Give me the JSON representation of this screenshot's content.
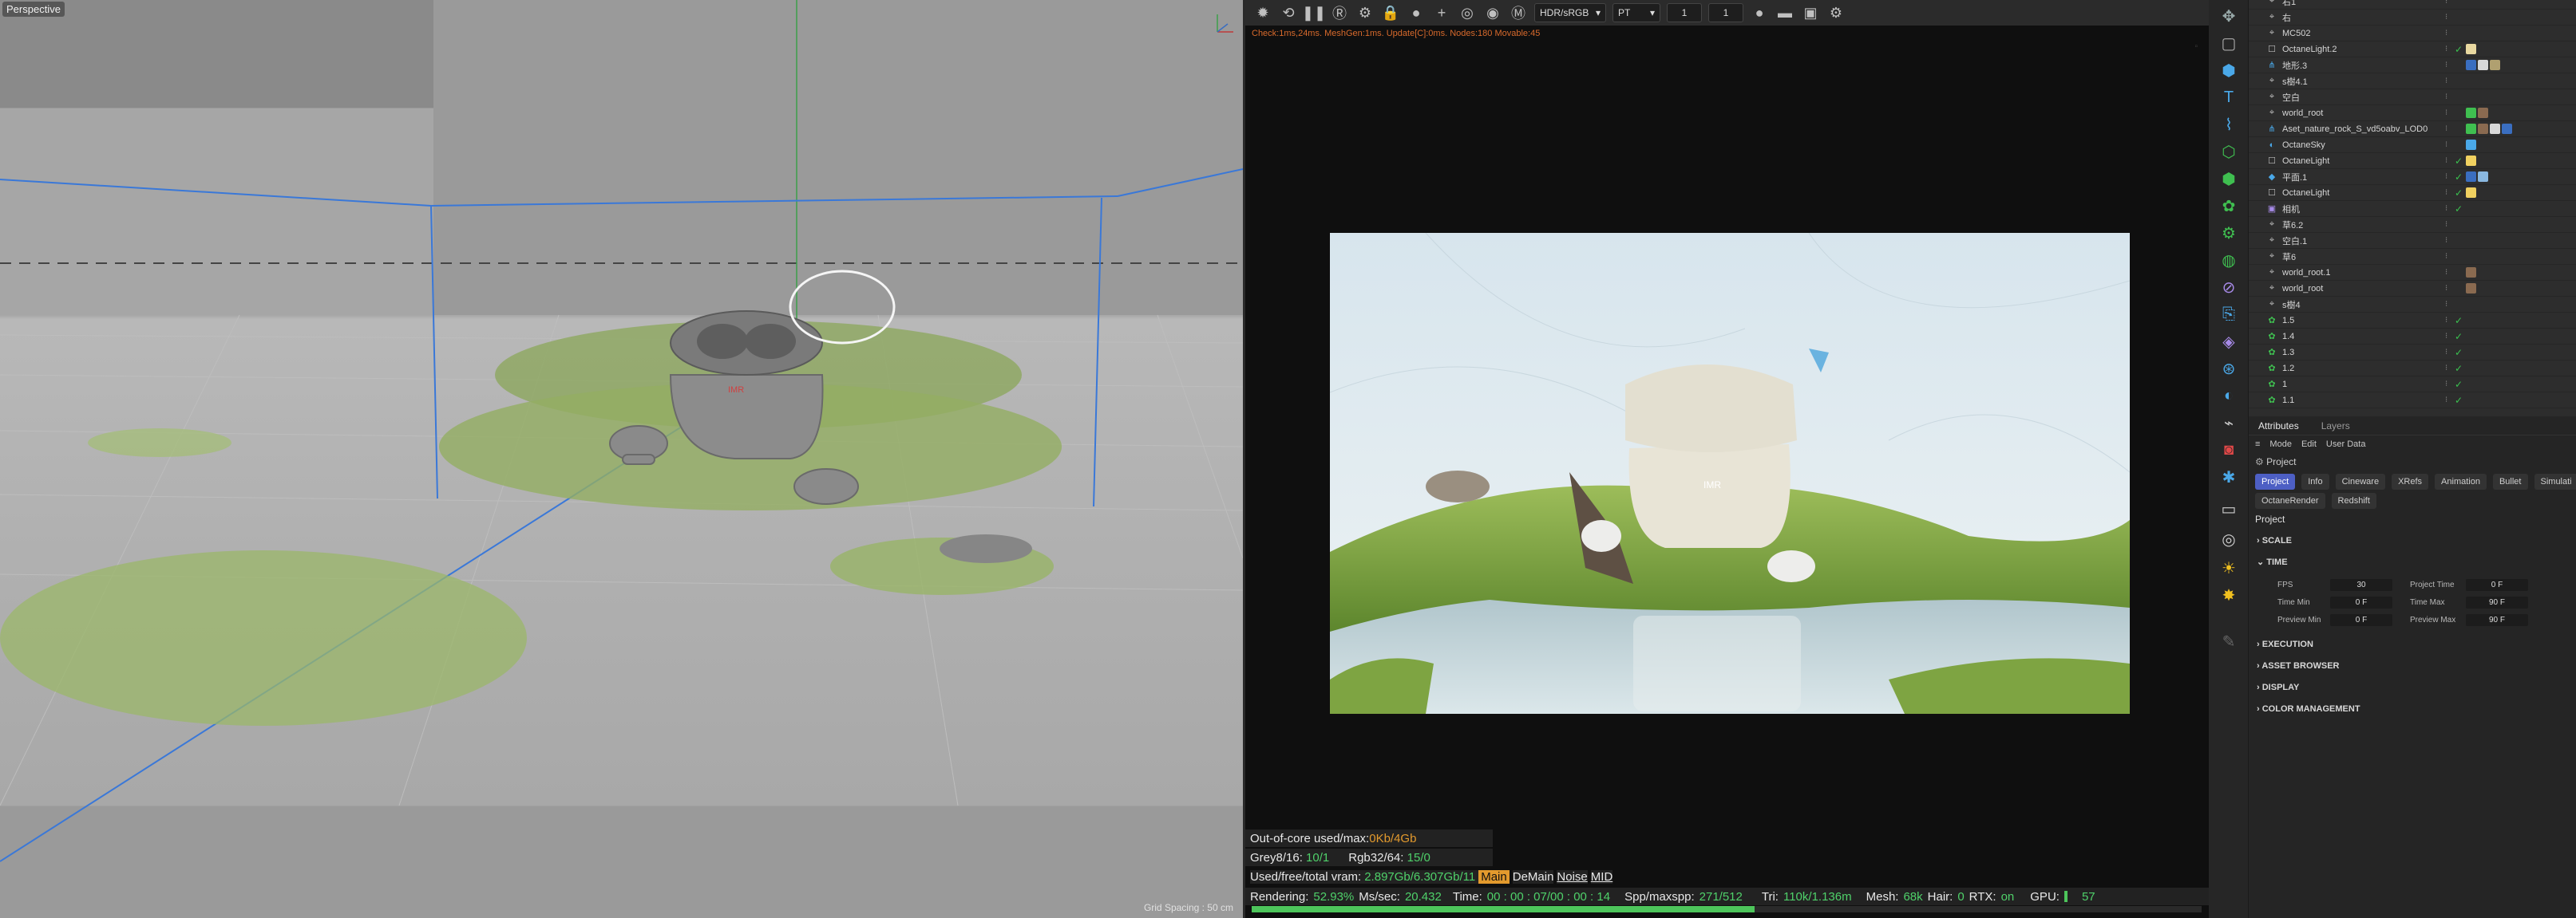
{
  "viewport": {
    "label": "Perspective",
    "grid_spacing": "Grid Spacing : 50 cm"
  },
  "render_window": {
    "toolbar": {
      "color_space": "HDR/sRGB",
      "kernel": "PT",
      "num1": "1",
      "num2": "1"
    },
    "check_line": "Check:1ms,24ms. MeshGen:1ms. Update[C]:0ms. Nodes:180 Movable:45",
    "stats": {
      "out_of_core_label": "Out-of-core used/max:",
      "out_of_core_value": "0Kb/4Gb",
      "grey_label": "Grey8/16:",
      "grey_value": "10/1",
      "rgb_label": "Rgb32/64:",
      "rgb_value": "15/0",
      "vram_label": "Used/free/total vram:",
      "vram_value": "2.897Gb/6.307Gb/11",
      "mode_main": "Main",
      "mode_demain": "DeMain",
      "mode_noise": "Noise",
      "mode_mid": "MID",
      "rendering_label": "Rendering:",
      "rendering_value": "52.93%",
      "mssec_label": "Ms/sec:",
      "mssec_value": "20.432",
      "time_label": "Time:",
      "time_value": "00 : 00 : 07/00 : 00 : 14",
      "spp_label": "Spp/maxspp:",
      "spp_value": "271/512",
      "tri_label": "Tri:",
      "tri_value": "110k/1.136m",
      "mesh_label": "Mesh:",
      "mesh_value": "68k",
      "hair_label": "Hair:",
      "hair_value": "0",
      "rtx_label": "RTX:",
      "rtx_value": "on",
      "gpu_label": "GPU:",
      "gpu_value": "57"
    },
    "progress": 0.5293
  },
  "objects": [
    {
      "name": "右1",
      "icon": "null-icon"
    },
    {
      "name": "右",
      "icon": "null-icon"
    },
    {
      "name": "MC502",
      "icon": "null-icon"
    },
    {
      "name": "OctaneLight.2",
      "icon": "light-icon"
    },
    {
      "name": "地形.3",
      "icon": "scatter-icon"
    },
    {
      "name": "s樹4.1",
      "icon": "null-icon"
    },
    {
      "name": "空白",
      "icon": "null-icon"
    },
    {
      "name": "world_root",
      "icon": "null-icon"
    },
    {
      "name": "Aset_nature_rock_S_vd5oabv_LOD0",
      "icon": "scatter-icon"
    },
    {
      "name": "OctaneSky",
      "icon": "sky-icon"
    },
    {
      "name": "OctaneLight",
      "icon": "light-icon"
    },
    {
      "name": "平面.1",
      "icon": "plane-icon"
    },
    {
      "name": "OctaneLight",
      "icon": "light-icon"
    },
    {
      "name": "相机",
      "icon": "camera-icon"
    },
    {
      "name": "草6.2",
      "icon": "null-icon"
    },
    {
      "name": "空白.1",
      "icon": "null-icon"
    },
    {
      "name": "草6",
      "icon": "null-icon"
    },
    {
      "name": "world_root.1",
      "icon": "null-icon"
    },
    {
      "name": "world_root",
      "icon": "null-icon"
    },
    {
      "name": "s樹4",
      "icon": "null-icon"
    },
    {
      "name": "1.5",
      "icon": "cloner-icon"
    },
    {
      "name": "1.4",
      "icon": "cloner-icon"
    },
    {
      "name": "1.3",
      "icon": "cloner-icon"
    },
    {
      "name": "1.2",
      "icon": "cloner-icon"
    },
    {
      "name": "1",
      "icon": "cloner-icon"
    },
    {
      "name": "1.1",
      "icon": "cloner-icon"
    }
  ],
  "attributes": {
    "tabs": [
      "Attributes",
      "Layers"
    ],
    "menu": [
      "Mode",
      "Edit",
      "User Data"
    ],
    "project_line": "Project",
    "tabs_row1": [
      "Project",
      "Info",
      "Cineware",
      "XRefs",
      "Animation",
      "Bullet",
      "Simulati"
    ],
    "tabs_row2": [
      "OctaneRender",
      "Redshift"
    ],
    "title": "Project",
    "sections": {
      "scale": "SCALE",
      "time": "TIME",
      "execution": "EXECUTION",
      "asset_browser": "ASSET BROWSER",
      "display": "DISPLAY",
      "color_management": "COLOR MANAGEMENT"
    },
    "fields": {
      "fps_label": "FPS",
      "fps_value": "30",
      "project_time_label": "Project Time",
      "project_time_value": "0 F",
      "time_min_label": "Time Min",
      "time_min_value": "0 F",
      "time_max_label": "Time Max",
      "time_max_value": "90 F",
      "preview_min_label": "Preview Min",
      "preview_min_value": "0 F",
      "preview_max_label": "Preview Max",
      "preview_max_value": "90 F"
    }
  },
  "colors": {
    "accent": "#4d5fc4",
    "ok_green": "#39c24f",
    "stat_green": "#4fd16a",
    "warning_orange": "#d86a2c"
  }
}
